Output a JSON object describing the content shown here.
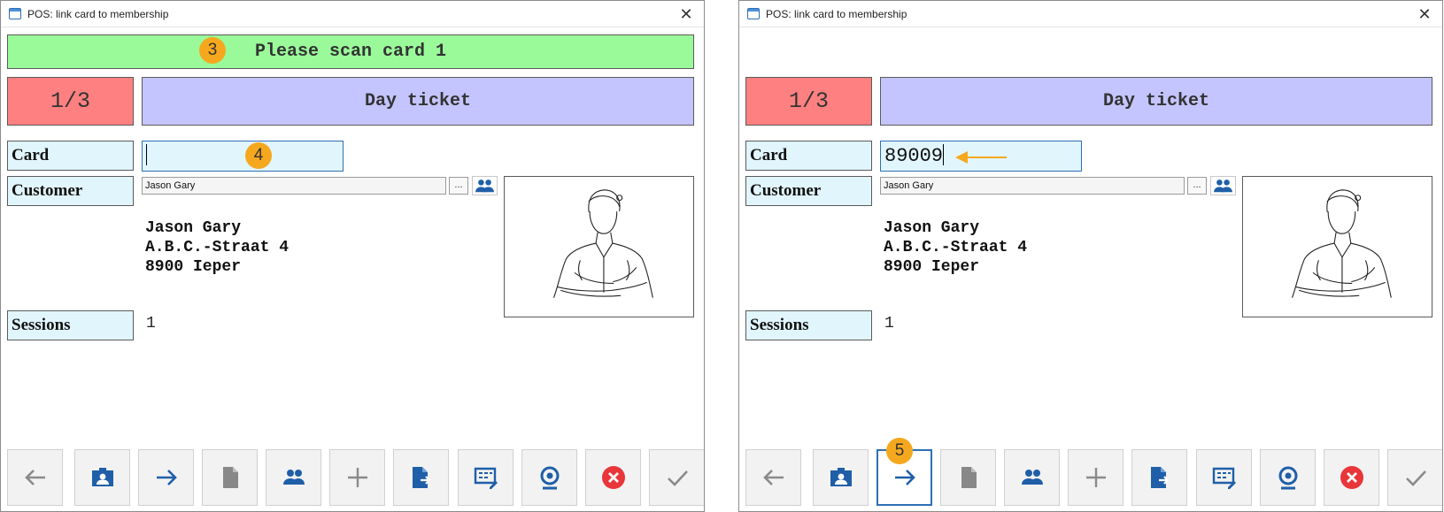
{
  "screens": [
    {
      "window_title": "POS: link card to membership",
      "close_label": "✕",
      "scan_prompt": "Please scan card 1",
      "counter": "1/3",
      "ticket_type": "Day ticket",
      "labels": {
        "card": "Card",
        "customer": "Customer",
        "sessions": "Sessions"
      },
      "card_value": "",
      "customer_field": "Jason Gary",
      "lookup_label": "...",
      "address": [
        "Jason Gary",
        "A.B.C.-Straat 4",
        "8900 Ieper"
      ],
      "sessions_value": "1",
      "callouts": [
        "3",
        "4"
      ]
    },
    {
      "window_title": "POS: link card to membership",
      "close_label": "✕",
      "scan_prompt": "",
      "counter": "1/3",
      "ticket_type": "Day ticket",
      "labels": {
        "card": "Card",
        "customer": "Customer",
        "sessions": "Sessions"
      },
      "card_value": "89009",
      "customer_field": "Jason Gary",
      "lookup_label": "...",
      "address": [
        "Jason Gary",
        "A.B.C.-Straat 4",
        "8900 Ieper"
      ],
      "sessions_value": "1",
      "callouts": [
        "5"
      ]
    }
  ],
  "toolbar_icons": [
    "back-arrow-icon",
    "contact-card-icon",
    "forward-arrow-icon",
    "document-icon",
    "people-icon",
    "plus-icon",
    "document-export-icon",
    "edit-form-icon",
    "webcam-icon",
    "cancel-icon",
    "checkmark-icon"
  ],
  "selected_toolbar": "forward-arrow-icon",
  "colors": {
    "scan_banner": "#9afa9a",
    "counter": "#ff8080",
    "ticket": "#c4c4ff",
    "field_bg": "#e1f5fd",
    "accent_blue": "#1f5fa8",
    "callout": "#f5a81e",
    "cancel_red": "#e8363a"
  }
}
